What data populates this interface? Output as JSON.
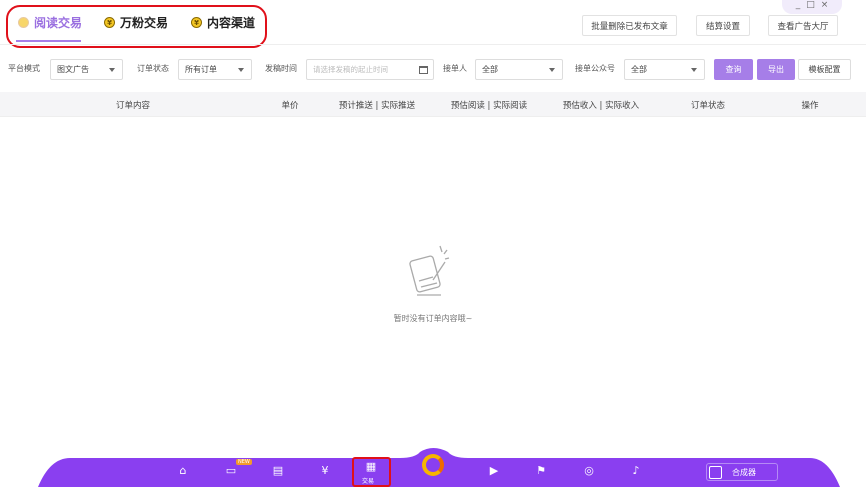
{
  "window_controls": {
    "minimize": "_",
    "maximize": "□",
    "close": "×"
  },
  "tabs": [
    {
      "label": "阅读交易",
      "icon": "yen-coin-icon",
      "active": true
    },
    {
      "label": "万粉交易",
      "icon": "yen-coin-icon"
    },
    {
      "label": "内容渠道",
      "icon": "yen-coin-icon"
    }
  ],
  "header_buttons": {
    "batch_delete": "批量删除已发布文章",
    "settlement": "结算设置",
    "ad_hall": "查看广告大厅"
  },
  "filters": {
    "platform_mode": {
      "label": "平台模式",
      "value": "图文广告"
    },
    "order_status": {
      "label": "订单状态",
      "value": "所有订单"
    },
    "publish_time": {
      "label": "发稿时间",
      "placeholder": "请选择发稿的起止时间"
    },
    "taker": {
      "label": "接单人",
      "value": "全部"
    },
    "account": {
      "label": "接单公众号",
      "value": "全部"
    },
    "query": "查询",
    "export": "导出",
    "template": "模板配置"
  },
  "table": {
    "columns": [
      "订单内容",
      "单价",
      "预计推送 | 实际推送",
      "预估阅读 | 实际阅读",
      "预估收入 | 实际收入",
      "订单状态",
      "操作"
    ]
  },
  "empty_text": "暂时没有订单内容哦~",
  "dock": {
    "new_badge": "NEW",
    "trade_label": "交易",
    "composer": "合成器"
  },
  "colors": {
    "accent": "#a67ee8",
    "dock": "#8a3ff0",
    "highlight": "#e0101a"
  }
}
